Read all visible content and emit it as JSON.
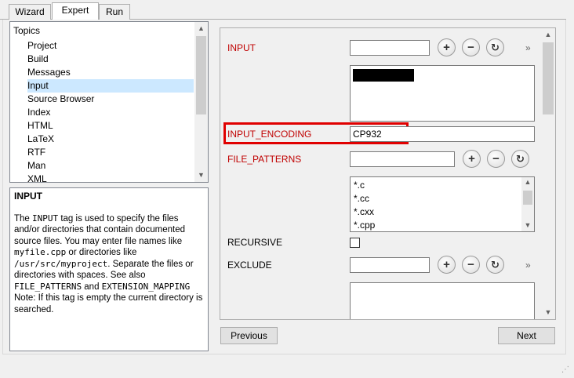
{
  "tabs": [
    {
      "label": "Wizard"
    },
    {
      "label": "Expert"
    },
    {
      "label": "Run"
    }
  ],
  "topics": {
    "title": "Topics",
    "items": [
      {
        "label": "Project"
      },
      {
        "label": "Build"
      },
      {
        "label": "Messages"
      },
      {
        "label": "Input"
      },
      {
        "label": "Source Browser"
      },
      {
        "label": "Index"
      },
      {
        "label": "HTML"
      },
      {
        "label": "LaTeX"
      },
      {
        "label": "RTF"
      },
      {
        "label": "Man"
      },
      {
        "label": "XML"
      }
    ],
    "selected": "Input"
  },
  "help": {
    "title": "INPUT",
    "p1": "The ",
    "p1_code": "INPUT",
    "p2": " tag is used to specify the files and/or directories that contain documented source files. You may enter file names like ",
    "p2_code": "myfile.cpp",
    "p3": " or directories like ",
    "p3_code": "/usr/src/myproject",
    "p4": ". Separate the files or directories with spaces. See also ",
    "p4_code": "FILE_PATTERNS",
    "p5": " and ",
    "p5_code": "EXTENSION_MAPPING",
    "note": "Note: If this tag is empty the current directory is searched."
  },
  "fields": {
    "input": {
      "label": "INPUT",
      "value": ""
    },
    "input_encoding": {
      "label": "INPUT_ENCODING",
      "value": "CP932"
    },
    "file_patterns": {
      "label": "FILE_PATTERNS",
      "value": "",
      "items": [
        "*.c",
        "*.cc",
        "*.cxx",
        "*.cpp"
      ]
    },
    "recursive": {
      "label": "RECURSIVE",
      "checked": false
    },
    "exclude": {
      "label": "EXCLUDE",
      "value": ""
    }
  },
  "buttons": {
    "add": "+",
    "remove": "−",
    "refresh": "↻",
    "more": "»",
    "previous": "Previous",
    "next": "Next"
  },
  "colors": {
    "label_red": "#c00000",
    "highlight_box": "#e00000",
    "selection": "#cce8ff"
  }
}
